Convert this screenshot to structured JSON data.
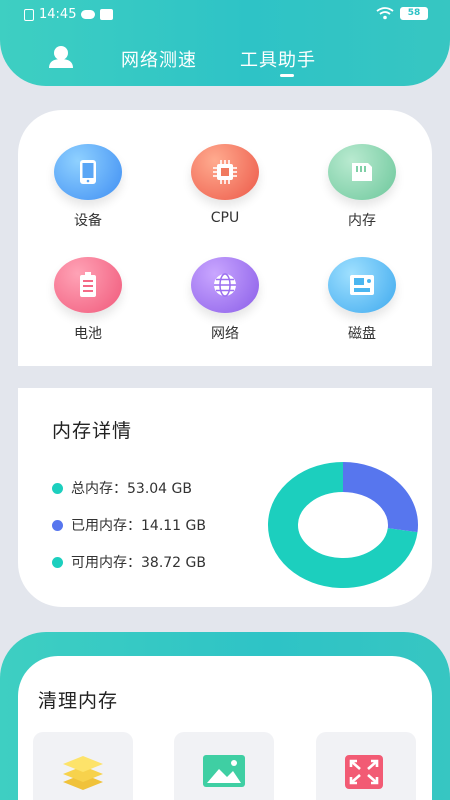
{
  "status_bar": {
    "time": "14:45",
    "battery": "58"
  },
  "nav": {
    "tabs": [
      {
        "label": "网络测速",
        "active": false
      },
      {
        "label": "工具助手",
        "active": true
      }
    ],
    "accent": "#2ec3c6"
  },
  "tools": [
    {
      "label": "设备",
      "icon": "phone-icon",
      "color": "#4a9cf4"
    },
    {
      "label": "CPU",
      "icon": "chip-icon",
      "color": "#f06b55"
    },
    {
      "label": "内存",
      "icon": "memory-card-icon",
      "color": "#7fcfa6"
    },
    {
      "label": "电池",
      "icon": "battery-icon",
      "color": "#f46a86"
    },
    {
      "label": "网络",
      "icon": "globe-icon",
      "color": "#9b6ff0"
    },
    {
      "label": "磁盘",
      "icon": "disk-icon",
      "color": "#4bb6f0"
    }
  ],
  "memory": {
    "title": "内存详情",
    "total_label": "总内存：53.04 GB",
    "used_label": "已用内存：14.11 GB",
    "free_label": "可用内存：38.72 GB",
    "total_gb": 53.04,
    "used_gb": 14.11,
    "free_gb": 38.72,
    "used_color": "#5776ee",
    "free_color": "#1ccfbe"
  },
  "clean": {
    "title": "清理内存",
    "items": [
      {
        "icon": "layers-icon"
      },
      {
        "icon": "image-icon"
      },
      {
        "icon": "expand-icon"
      }
    ]
  }
}
